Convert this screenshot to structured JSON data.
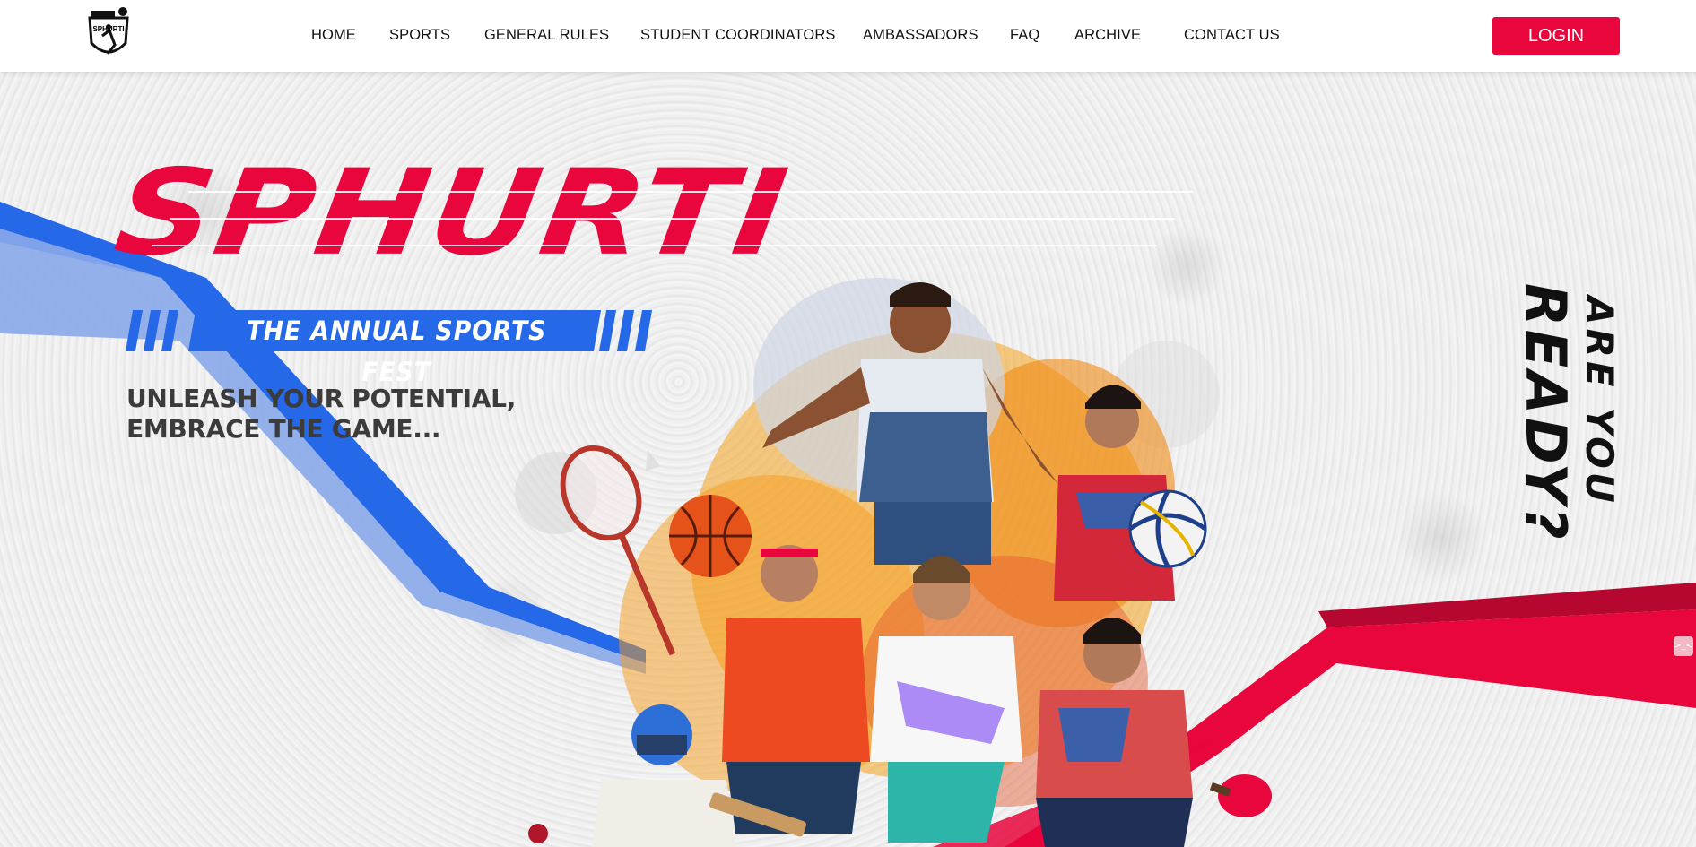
{
  "logo": {
    "text": "SPHURTI"
  },
  "nav": {
    "items": [
      {
        "label": "HOME"
      },
      {
        "label": "SPORTS"
      },
      {
        "label": "GENERAL RULES"
      },
      {
        "label": "STUDENT COORDINATORS"
      },
      {
        "label": "AMBASSADORS"
      },
      {
        "label": "FAQ"
      },
      {
        "label": "ARCHIVE"
      },
      {
        "label": "CONTACT US"
      }
    ],
    "login_label": "LOGIN"
  },
  "hero": {
    "title": "SPHURTI",
    "tagline": "THE ANNUAL SPORTS FEST",
    "slogan_line1": "UNLEASH YOUR POTENTIAL,",
    "slogan_line2": "EMBRACE THE GAME...",
    "vertical_line1": "ARE YOU",
    "vertical_line2": "READY?"
  },
  "widget": {
    "icon": "expand-icon",
    "glyph": ">_<"
  },
  "colors": {
    "accent_red": "#e8063c",
    "accent_blue": "#2569e8",
    "slogan_gray": "#3b3b3b",
    "dark": "#111111"
  },
  "icons": {
    "logo": "sphurti-crest-logo",
    "badminton": "badminton-racket-icon",
    "basketball": "basketball-icon",
    "volleyball": "volleyball-icon",
    "cricket": "cricket-bat-icon",
    "table_tennis": "table-tennis-paddle-icon"
  }
}
